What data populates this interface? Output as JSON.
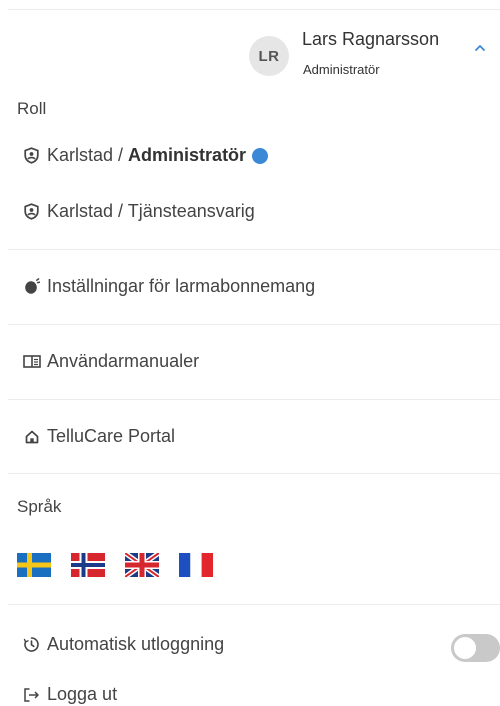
{
  "user": {
    "initials": "LR",
    "name": "Lars Ragnarsson",
    "role": "Administratör"
  },
  "roles_section": {
    "label": "Roll",
    "items": [
      {
        "place": "Karlstad / ",
        "title": "Administratör",
        "active": true
      },
      {
        "label": "Karlstad / Tjänsteansvarig",
        "active": false
      }
    ]
  },
  "menu": {
    "alarm_settings": "Inställningar för larmabonnemang",
    "manuals": "Användarmanualer",
    "portal": "TelluCare Portal"
  },
  "language": {
    "label": "Språk",
    "flags": [
      "swedish-flag",
      "norwegian-flag",
      "uk-flag",
      "french-flag"
    ]
  },
  "auto_logout": {
    "label": "Automatisk utloggning",
    "enabled": false
  },
  "logout": {
    "label": "Logga ut"
  },
  "colors": {
    "accent": "#3b88d6",
    "toggle_off": "#c9c9c9"
  }
}
